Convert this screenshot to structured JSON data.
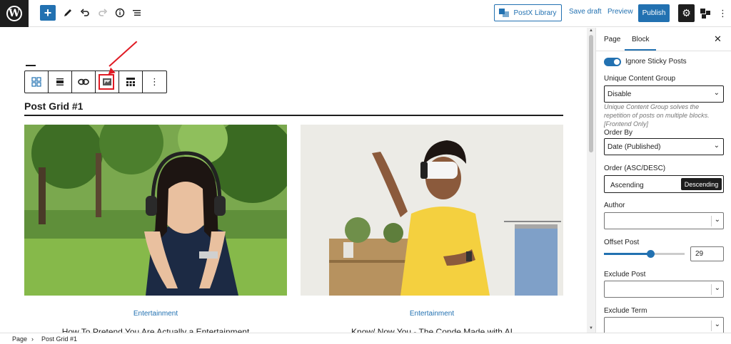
{
  "topbar": {
    "postx_label": "PostX Library",
    "save_draft": "Save draft",
    "preview": "Preview",
    "publish": "Publish"
  },
  "canvas": {
    "block_title": "Post Grid #1",
    "cards": [
      {
        "category": "Entertainment",
        "title": "How To Pretend You Are Actually a Entertainment"
      },
      {
        "category": "Entertainment",
        "title": "Know/ Now You - The Conde Made with AI"
      }
    ]
  },
  "sidebar": {
    "tabs": [
      "Page",
      "Block"
    ],
    "active_tab": "Block",
    "ignore_sticky": "Ignore Sticky Posts",
    "unique_group_label": "Unique Content Group",
    "unique_group_value": "Disable",
    "unique_group_help": "Unique Content Group solves the repetition of posts on multiple blocks.[Frontend Only]",
    "order_by_label": "Order By",
    "order_by_value": "Date (Published)",
    "order_label": "Order (ASC/DESC)",
    "ascending": "Ascending",
    "descending": "Descending",
    "author_label": "Author",
    "offset_label": "Offset Post",
    "offset_value": "29",
    "offset_fraction": 0.58,
    "exclude_post_label": "Exclude Post",
    "exclude_term_label": "Exclude Term"
  },
  "footer": {
    "crumb_page": "Page",
    "crumb_sep": "›",
    "crumb_block": "Post Grid #1"
  },
  "colors": {
    "accent": "#2271b1",
    "highlight": "#e01b24",
    "dark": "#1e1e1e"
  }
}
